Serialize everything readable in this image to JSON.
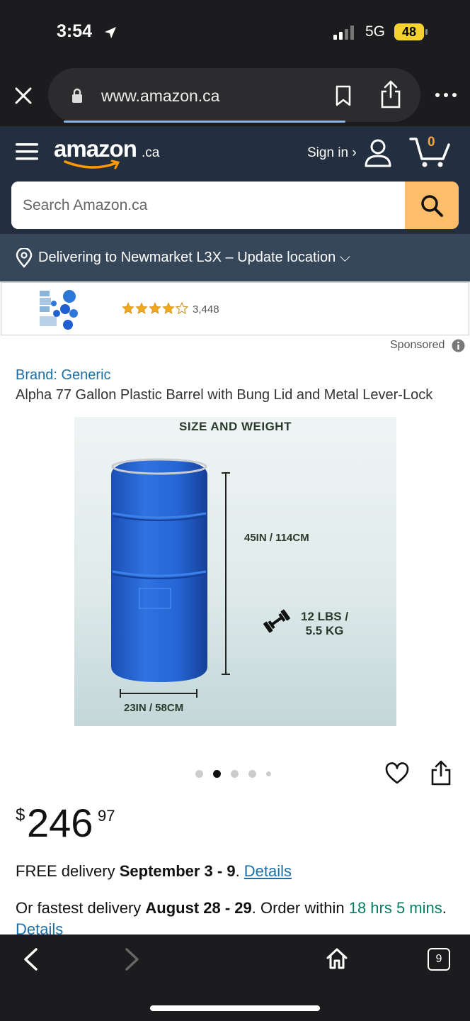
{
  "status": {
    "time": "3:54",
    "network": "5G",
    "battery": "48"
  },
  "browser": {
    "url": "www.amazon.ca",
    "tab_count": "9"
  },
  "header": {
    "logo": "amazon",
    "logo_suffix": ".ca",
    "signin": "Sign in ›",
    "cart_count": "0"
  },
  "search": {
    "placeholder": "Search Amazon.ca"
  },
  "delivery": {
    "text": "Delivering to Newmarket L3X – Update location ⌵"
  },
  "ad": {
    "rating": 4,
    "reviews": "3,448",
    "sponsored": "Sponsored"
  },
  "product": {
    "brand": "Brand: Generic",
    "title": "Alpha 77 Gallon Plastic Barrel with Bung Lid and Metal Lever-Lock",
    "image": {
      "heading": "SIZE AND WEIGHT",
      "height": "45IN / 114CM",
      "width": "23IN / 58CM",
      "weight_line1": "12 LBS /",
      "weight_line2": "5.5 KG"
    },
    "gallery": {
      "count": 5,
      "active": 1
    }
  },
  "price": {
    "symbol": "$",
    "main": "246",
    "cents": "97"
  },
  "shipping": {
    "free_prefix": "FREE delivery ",
    "free_dates": "September 3 - 9",
    "free_sep": ". ",
    "details": "Details",
    "fast_prefix": "Or fastest delivery ",
    "fast_dates": "August 28 - 29",
    "fast_mid": ". Order within ",
    "fast_time": "18 hrs 5 mins",
    "fast_sep": ". ",
    "fast_details": "Details"
  },
  "colors": {
    "amazon_dark": "#232f3e",
    "search_btn": "#febd69",
    "link": "#1d6fa5",
    "barrel": "#1f5fd1"
  }
}
